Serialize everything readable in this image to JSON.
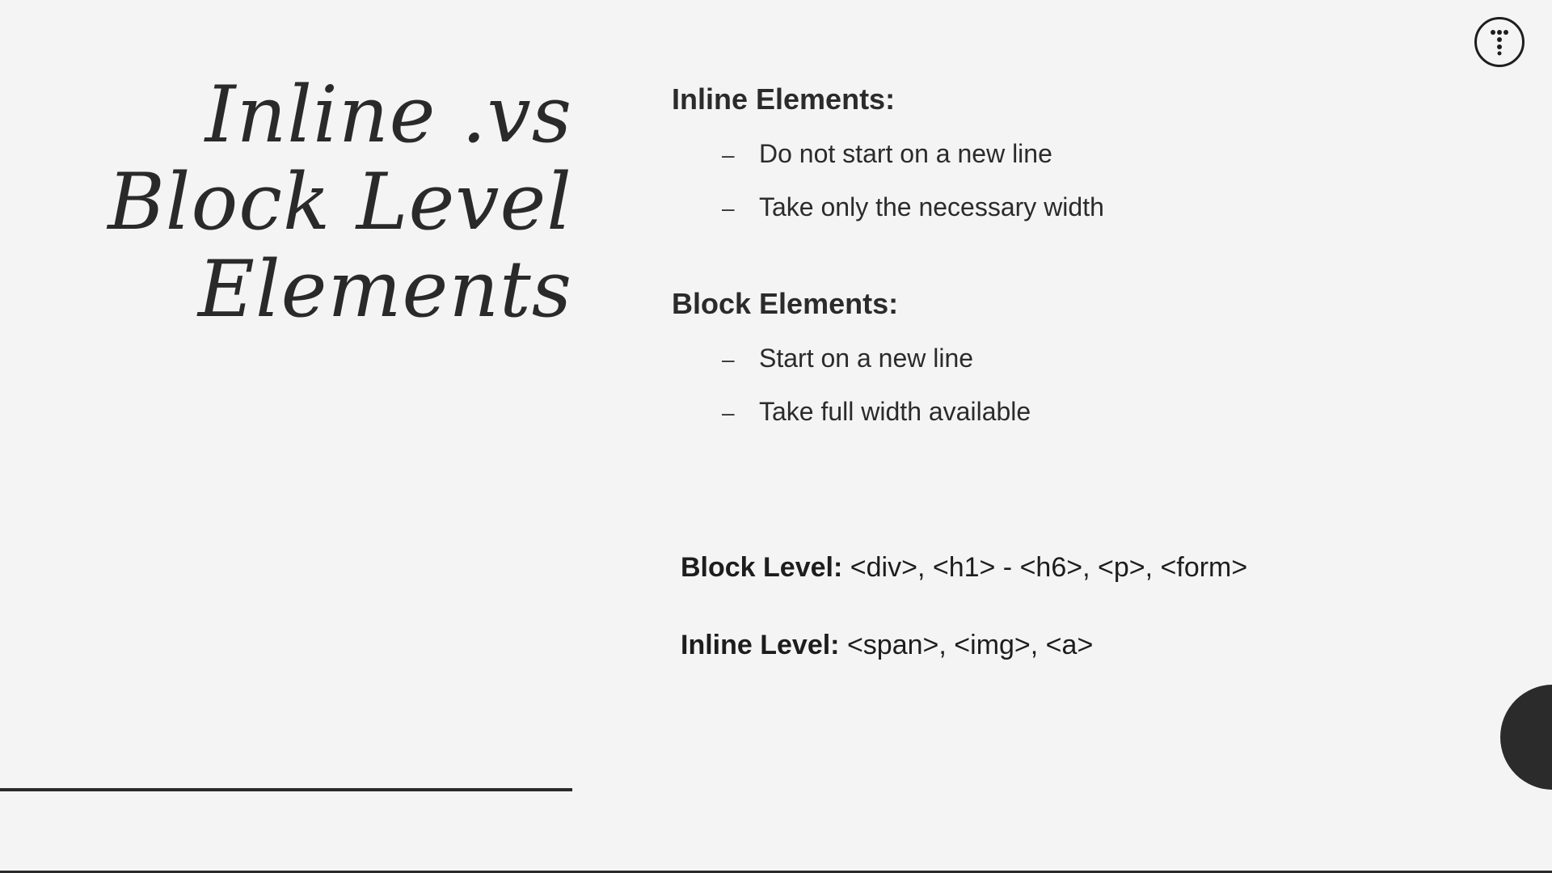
{
  "slide": {
    "title_lines": [
      "Inline .vs",
      "Block Level",
      "Elements"
    ],
    "inline_section": {
      "heading": "Inline Elements:",
      "items": [
        {
          "dash": "–",
          "text": "Do not start on a new line"
        },
        {
          "dash": "–",
          "text": "Take only the necessary width"
        }
      ]
    },
    "block_section": {
      "heading": "Block Elements:",
      "items": [
        {
          "dash": "–",
          "text": "Start on a new line"
        },
        {
          "dash": "–",
          "text": "Take full width available"
        }
      ]
    },
    "examples": {
      "block": {
        "label": "Block Level:",
        "value": "<div>, <h1> - <h6>, <p>, <form>"
      },
      "inline": {
        "label": "Inline Level:",
        "value": "<span>, <img>, <a>"
      }
    }
  },
  "icons": {
    "corner": "menu-dots-icon",
    "decor": "dark-circle"
  },
  "colors": {
    "background": "#f4f4f4",
    "text": "#2b2b2b",
    "accent_dark": "#2a2a2a"
  }
}
